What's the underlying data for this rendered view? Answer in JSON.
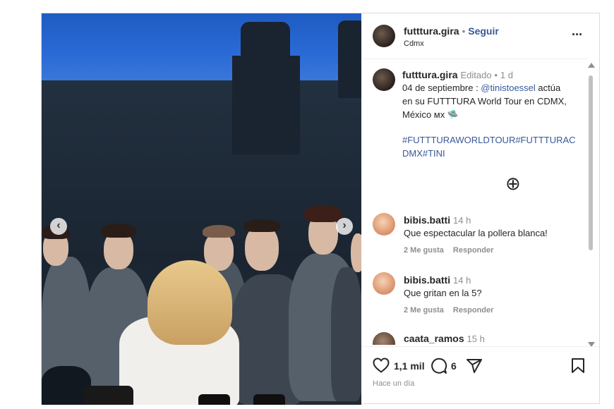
{
  "header": {
    "username": "futttura.gira",
    "separator": "•",
    "follow_label": "Seguir",
    "location": "Cdmx",
    "more_icon": "more-horizontal-icon",
    "more_glyph": "···"
  },
  "caption": {
    "username": "futttura.gira",
    "edited": "Editado",
    "dot": "•",
    "age": "1 d",
    "line1_pre": "04 de septiembre : ",
    "mention": "@tinistoessel",
    "line1_post": " actúa",
    "line2": "en su FUTTTURA World Tour en CDMX,",
    "line3": "México ᴍx 🛸",
    "hashtags_line1": "#FUTTTURAWORLDTOUR#FUTTTURAC",
    "hashtags_line2": "DMX#TINI"
  },
  "load_more": {
    "icon": "plus-circle-icon",
    "glyph": "⊕"
  },
  "comments": [
    {
      "username": "bibis.batti",
      "age": "14 h",
      "text": "Que espectacular la pollera blanca!",
      "likes": "2 Me gusta",
      "reply": "Responder"
    },
    {
      "username": "bibis.batti",
      "age": "14 h",
      "text": "Que gritan en la 5?",
      "likes": "2 Me gusta",
      "reply": "Responder"
    },
    {
      "username": "caata_ramos",
      "age": "15 h",
      "text": "",
      "likes": "",
      "reply": ""
    }
  ],
  "actions": {
    "like_icon": "heart-icon",
    "like_count": "1,1 mil",
    "comment_icon": "comment-icon",
    "comment_count": "6",
    "share_icon": "send-icon",
    "save_icon": "bookmark-icon",
    "timestamp": "Hace un día"
  },
  "media": {
    "prev_icon": "chevron-left-icon",
    "next_icon": "chevron-right-icon",
    "prev_glyph": "‹",
    "next_glyph": "›"
  },
  "colors": {
    "link": "#385898",
    "muted": "#8e8e8e",
    "text": "#262626"
  }
}
